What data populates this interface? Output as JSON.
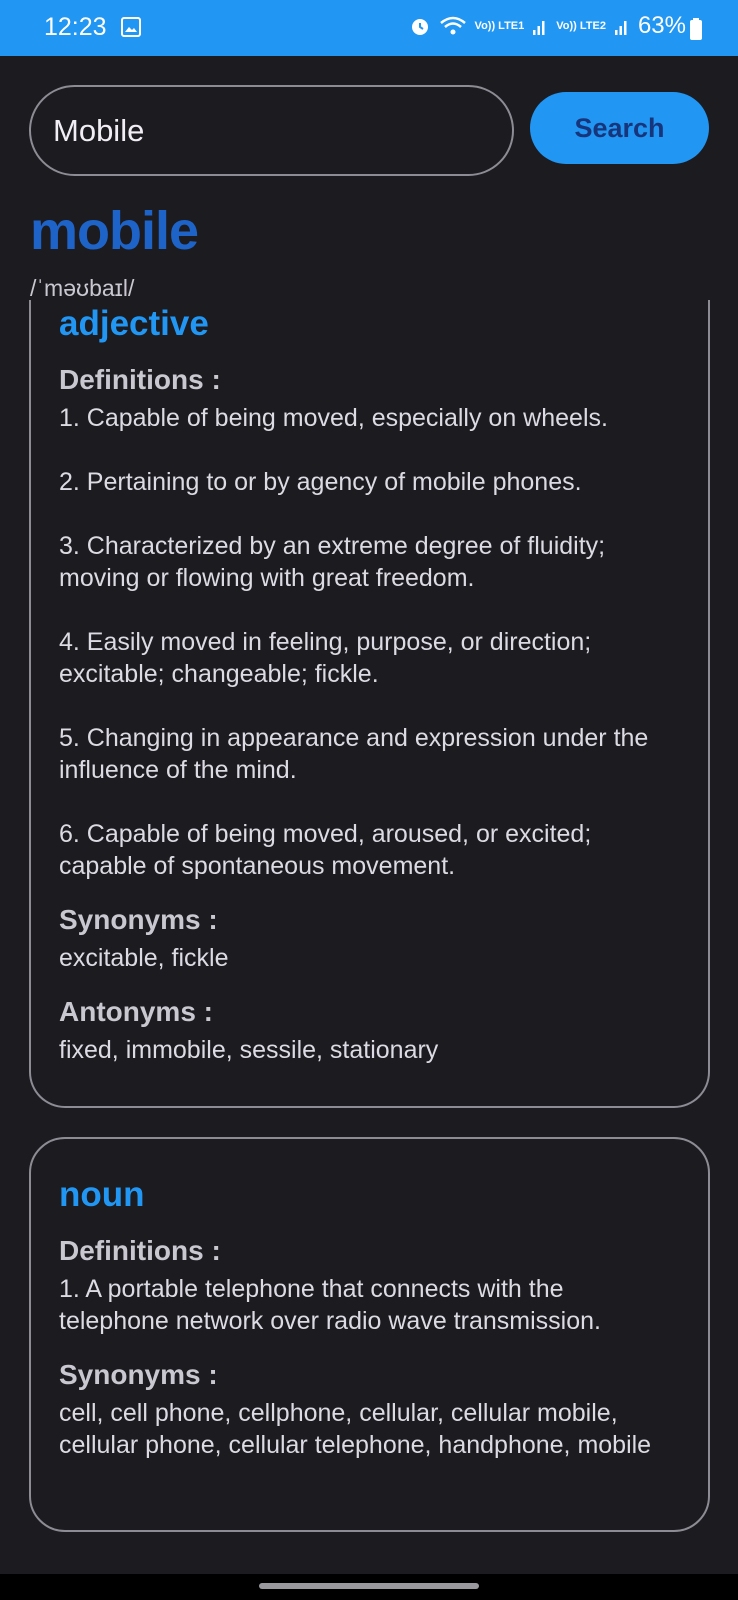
{
  "status_bar": {
    "time": "12:23",
    "lte1": "Vo)) LTE1",
    "lte2": "Vo)) LTE2",
    "battery": "63%",
    "icons": [
      "gallery-icon",
      "alarm-icon",
      "wifi-icon",
      "signal-icon",
      "signal-icon",
      "battery-icon"
    ]
  },
  "search": {
    "value": "Mobile",
    "button_label": "Search"
  },
  "word": {
    "title": "mobile",
    "phonetic": "/ˈməʊbaɪl/"
  },
  "meanings": [
    {
      "part_of_speech": "adjective",
      "definitions_heading": "Definitions :",
      "definitions": [
        "1. Capable of being moved, especially on wheels.",
        "2. Pertaining to or by agency of mobile phones.",
        "3. Characterized by an extreme degree of fluidity; moving or flowing with great freedom.",
        "4. Easily moved in feeling, purpose, or direction; excitable; changeable; fickle.",
        "5. Changing in appearance and expression under the influence of the mind.",
        "6. Capable of being moved, aroused, or excited; capable of spontaneous movement."
      ],
      "synonyms_heading": "Synonyms :",
      "synonyms": "excitable, fickle",
      "antonyms_heading": "Antonyms :",
      "antonyms": "fixed, immobile, sessile, stationary"
    },
    {
      "part_of_speech": "noun",
      "definitions_heading": "Definitions :",
      "definitions": [
        "1. A portable telephone that connects with the telephone network over radio wave transmission."
      ],
      "synonyms_heading": "Synonyms :",
      "synonyms": "cell, cell phone, cellphone, cellular, cellular mobile, cellular phone, cellular telephone, handphone, mobile"
    }
  ],
  "colors": {
    "accent": "#2196f3",
    "title": "#1e63c8",
    "background": "#1c1b20"
  }
}
